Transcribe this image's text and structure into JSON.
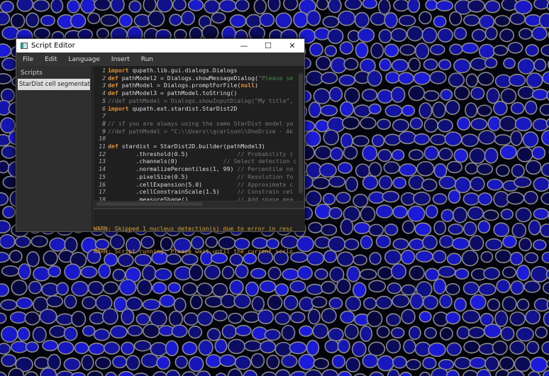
{
  "window": {
    "title": "Script Editor",
    "minimize": "—",
    "maximize": "☐",
    "close": "✕"
  },
  "menu": [
    "File",
    "Edit",
    "Language",
    "Insert",
    "Run"
  ],
  "scripts": {
    "header": "Scripts",
    "items": [
      "StarDist cell segmentation"
    ]
  },
  "code": [
    [
      [
        "kw",
        "import"
      ],
      [
        "",
        "qupath.lib.gui.dialogs.Dialogs"
      ]
    ],
    [
      [
        "kw",
        "def"
      ],
      [
        "",
        "pathModel2 = Dialogs.showMessageDialog("
      ],
      [
        "st",
        "\"Please se"
      ]
    ],
    [
      [
        "kw",
        "def"
      ],
      [
        "",
        "pathModel = Dialogs.promptForFile("
      ],
      [
        "kw",
        "null"
      ],
      [
        "",
        ")"
      ]
    ],
    [
      [
        "kw",
        "def"
      ],
      [
        "",
        "pathModel3 = pathModel.toString()"
      ]
    ],
    [
      [
        "cm",
        "//def pathModel = Dialogs.showInputDialog(\"My title\","
      ]
    ],
    [
      [
        "kw",
        "import"
      ],
      [
        "",
        "qupath.ext.stardist.StarDist2D"
      ]
    ],
    [],
    [
      [
        "cm",
        "// if you are always using the same StarDist model yo"
      ]
    ],
    [
      [
        "cm",
        "//def pathModel = \"C:\\\\Users\\\\gcarlson\\\\OneDrive - Ak"
      ]
    ],
    [],
    [
      [
        "kw",
        "def"
      ],
      [
        "",
        "stardist = StarDist2D.builder(pathModel3)"
      ]
    ],
    [
      [
        "",
        "        .threshold(0.5)              "
      ],
      [
        "cm",
        "// Probability ("
      ]
    ],
    [
      [
        "",
        "        .channels(0)             "
      ],
      [
        "cm",
        "// Select detection c"
      ]
    ],
    [
      [
        "",
        "        .normalizePercentiles(1, 99) "
      ],
      [
        "cm",
        "// Percentile no"
      ]
    ],
    [
      [
        "",
        "        .pixelSize(0.5)              "
      ],
      [
        "cm",
        "// Resolution fo"
      ]
    ],
    [
      [
        "",
        "        .cellExpansion(5.0)          "
      ],
      [
        "cm",
        "// Approximate c"
      ]
    ],
    [
      [
        "",
        "        .cellConstrainScale(1.5)     "
      ],
      [
        "cm",
        "// Constrain cel"
      ]
    ],
    [
      [
        "",
        "        .measureShape()              "
      ],
      [
        "cm",
        "// Add shape mea"
      ]
    ]
  ],
  "console": [
    "WARN: Skipped 1 nucleus detection(s) due to error in resc",
    "WARN: Script running: Please wait until the current scrip"
  ],
  "colors": {
    "keyword": "#e8902a",
    "comment": "#777777",
    "warn": "#d9a030",
    "cells": "#1a1aff",
    "outlines": "#8a8a8a"
  }
}
